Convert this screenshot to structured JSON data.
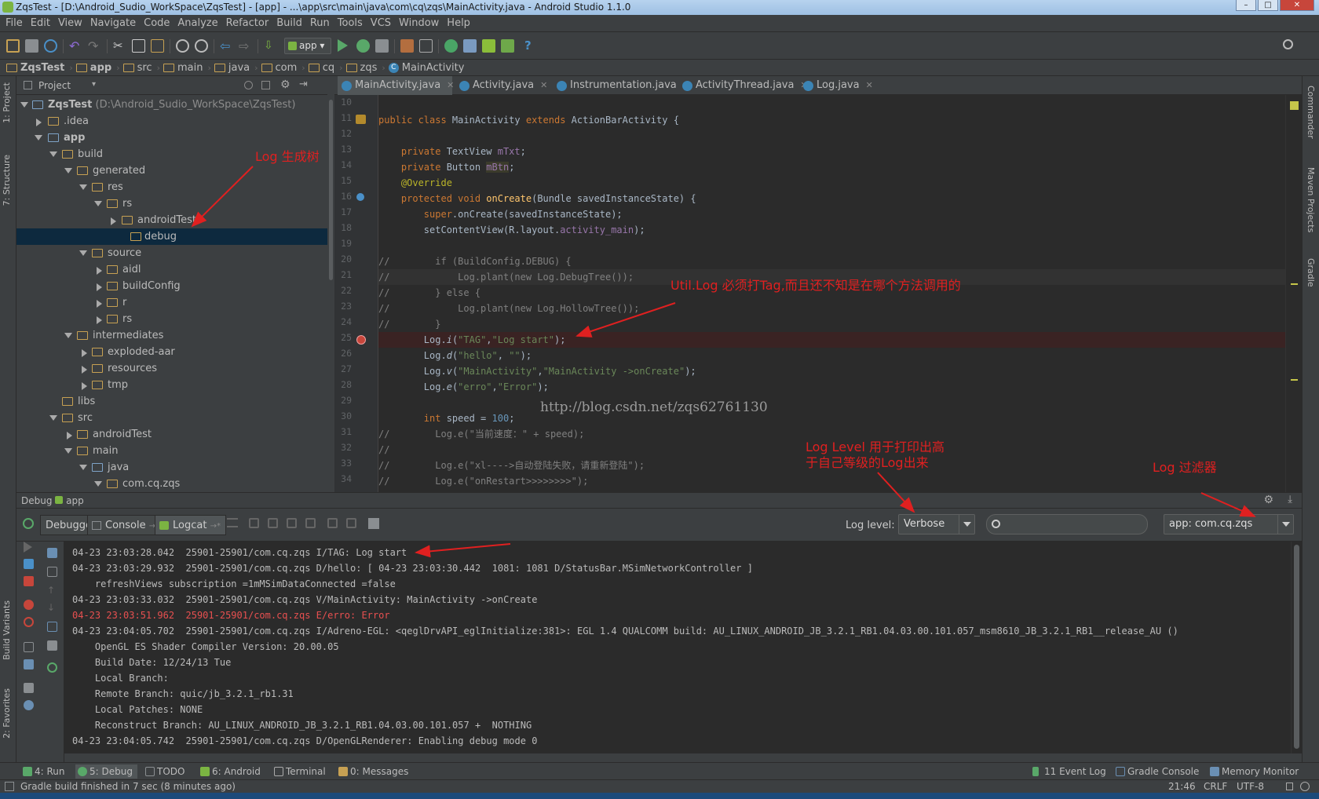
{
  "window": {
    "title": "ZqsTest - [D:\\Android_Sudio_WorkSpace\\ZqsTest] - [app] - ...\\app\\src\\main\\java\\com\\cq\\zqs\\MainActivity.java - Android Studio 1.1.0"
  },
  "menu": [
    "File",
    "Edit",
    "View",
    "Navigate",
    "Code",
    "Analyze",
    "Refactor",
    "Build",
    "Run",
    "Tools",
    "VCS",
    "Window",
    "Help"
  ],
  "toolbar": {
    "run_config": "app",
    "help": "?"
  },
  "breadcrumb": [
    "ZqsTest",
    "app",
    "src",
    "main",
    "java",
    "com",
    "cq",
    "zqs",
    "MainActivity"
  ],
  "left_strip": {
    "project": "1: Project",
    "structure": "7: Structure",
    "build_variants": "Build Variants",
    "favorites": "2: Favorites"
  },
  "right_strip": {
    "commander": "Commander",
    "maven": "Maven Projects",
    "gradle": "Gradle"
  },
  "project_panel": {
    "header": "Project",
    "tree": [
      {
        "label": "ZqsTest",
        "path": "(D:\\Android_Sudio_WorkSpace\\ZqsTest)"
      },
      {
        "label": ".idea"
      },
      {
        "label": "app"
      },
      {
        "label": "build"
      },
      {
        "label": "generated"
      },
      {
        "label": "res"
      },
      {
        "label": "rs"
      },
      {
        "label": "androidTest"
      },
      {
        "label": "debug"
      },
      {
        "label": "source"
      },
      {
        "label": "aidl"
      },
      {
        "label": "buildConfig"
      },
      {
        "label": "r"
      },
      {
        "label": "rs"
      },
      {
        "label": "intermediates"
      },
      {
        "label": "exploded-aar"
      },
      {
        "label": "resources"
      },
      {
        "label": "tmp"
      },
      {
        "label": "libs"
      },
      {
        "label": "src"
      },
      {
        "label": "androidTest"
      },
      {
        "label": "main"
      },
      {
        "label": "java"
      },
      {
        "label": "com.cq.zqs"
      }
    ]
  },
  "editor": {
    "tabs": [
      "MainActivity.java",
      "Activity.java",
      "Instrumentation.java",
      "ActivityThread.java",
      "Log.java"
    ],
    "line_numbers": [
      "10",
      "11",
      "12",
      "13",
      "14",
      "15",
      "16",
      "17",
      "18",
      "19",
      "20",
      "21",
      "22",
      "23",
      "24",
      "25",
      "26",
      "27",
      "28",
      "29",
      "30",
      "31",
      "32",
      "33",
      "34"
    ],
    "watermark": "http://blog.csdn.net/zqs62761130"
  },
  "annotations": {
    "tree": "Log 生成树",
    "tag": "Util.Log 必须打Tag,而且还不知是在哪个方法调用的",
    "level_line1": "Log Level 用于打印出高",
    "level_line2": "于自己等级的Log出来",
    "filter": "Log 过滤器"
  },
  "debug_panel": {
    "header": "Debug",
    "config": "app",
    "tabs": [
      "Debugger",
      "Console",
      "Logcat"
    ],
    "log_level_label": "Log level:",
    "log_level_value": "Verbose",
    "search_placeholder": "",
    "filter_value": "app: com.cq.zqs",
    "log_lines": [
      "04-23 23:03:28.042  25901-25901/com.cq.zqs I/TAG: Log start",
      "04-23 23:03:29.932  25901-25901/com.cq.zqs D/hello: [ 04-23 23:03:30.442  1081: 1081 D/StatusBar.MSimNetworkController ]",
      "    refreshViews subscription =1mMSimDataConnected =false",
      "04-23 23:03:33.032  25901-25901/com.cq.zqs V/MainActivity: MainActivity ->onCreate",
      "04-23 23:03:51.962  25901-25901/com.cq.zqs E/erro: Error",
      "04-23 23:04:05.702  25901-25901/com.cq.zqs I/Adreno-EGL: <qeglDrvAPI_eglInitialize:381>: EGL 1.4 QUALCOMM build: AU_LINUX_ANDROID_JB_3.2.1_RB1.04.03.00.101.057_msm8610_JB_3.2.1_RB1__release_AU ()",
      "    OpenGL ES Shader Compiler Version: 20.00.05",
      "    Build Date: 12/24/13 Tue",
      "    Local Branch:",
      "    Remote Branch: quic/jb_3.2.1_rb1.31",
      "    Local Patches: NONE",
      "    Reconstruct Branch: AU_LINUX_ANDROID_JB_3.2.1_RB1.04.03.00.101.057 +  NOTHING",
      "04-23 23:04:05.742  25901-25901/com.cq.zqs D/OpenGLRenderer: Enabling debug mode 0"
    ]
  },
  "bottom_tabs": [
    "4: Run",
    "5: Debug",
    "TODO",
    "6: Android",
    "Terminal",
    "0: Messages"
  ],
  "bottom_tabs_right": [
    "11 Event Log",
    "Gradle Console",
    "Memory Monitor"
  ],
  "status": {
    "message": "Gradle build finished in 7 sec (8 minutes ago)",
    "position": "21:46",
    "line_sep": "CRLF",
    "encoding": "UTF-8"
  },
  "colors": {
    "error_log": "#e85050",
    "annotation": "#e02020",
    "selection": "#0d293e"
  }
}
